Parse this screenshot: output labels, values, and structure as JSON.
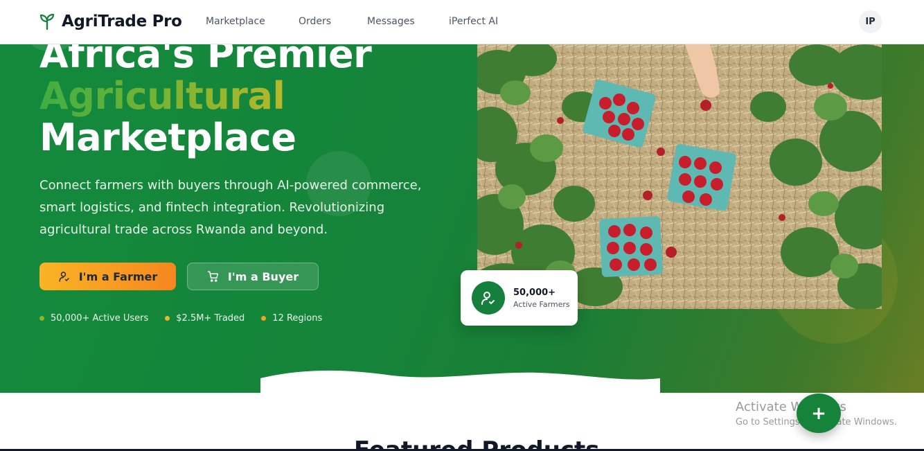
{
  "brand": {
    "name": "AgriTrade Pro",
    "icon": "sprout-icon"
  },
  "nav": {
    "links": [
      "Marketplace",
      "Orders",
      "Messages",
      "iPerfect AI"
    ]
  },
  "user": {
    "initials": "IP"
  },
  "hero": {
    "title_line1": "Africa's Premier",
    "title_line2": "Agricultural",
    "title_line3": "Marketplace",
    "subtitle": "Connect farmers with buyers through AI-powered commerce, smart logistics, and fintech integration. Revolutionizing agricultural trade across Rwanda and beyond.",
    "farmer_button": "I'm a Farmer",
    "buyer_button": "I'm a Buyer",
    "stats": [
      {
        "text": "50,000+ Active Users",
        "color": "#8fb52e"
      },
      {
        "text": "$2.5M+ Traded",
        "color": "#e4b929"
      },
      {
        "text": "12 Regions",
        "color": "#f2a326"
      }
    ],
    "card": {
      "number": "50,000+",
      "label": "Active Farmers",
      "icon": "user-check-icon"
    }
  },
  "featured": {
    "title": "Featured Products"
  },
  "windows_notice": {
    "title": "Activate Windows",
    "subtitle": "Go to Settings to activate Windows."
  },
  "fab": {
    "label": "+"
  },
  "colors": {
    "brand_green": "#15843a",
    "accent_orange": "#f6871f",
    "accent_yellow": "#f9b424"
  }
}
